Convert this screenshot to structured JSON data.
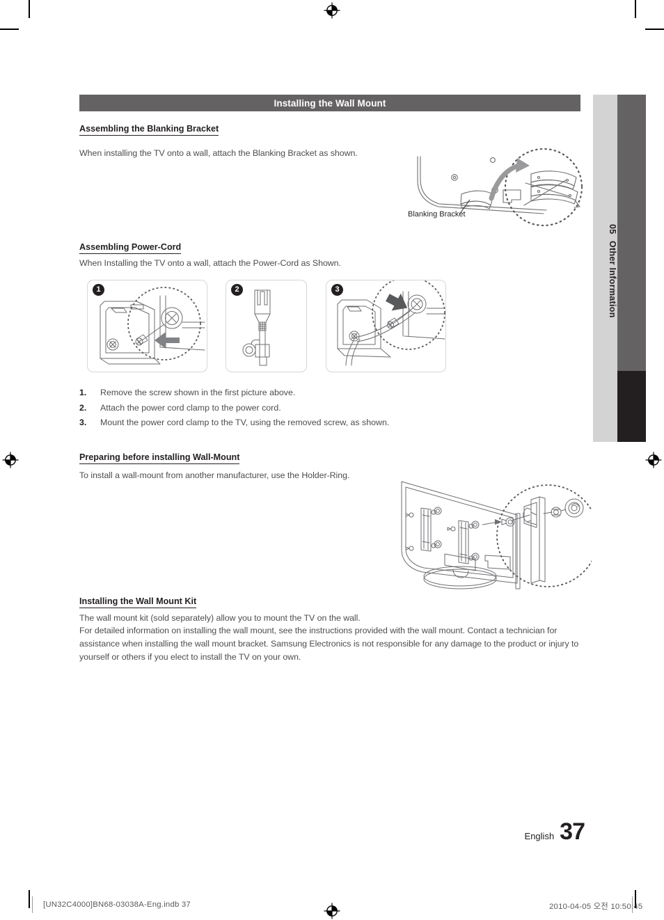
{
  "document": {
    "section_title": "Installing the Wall Mount",
    "language": "English",
    "page_number": "37"
  },
  "sidebar": {
    "chapter_number": "05",
    "chapter_label": "Other Information",
    "colors": {
      "light": "#d3d3d3",
      "dark": "#656263",
      "black": "#231f20"
    }
  },
  "sections": {
    "blanking_bracket": {
      "heading": "Assembling the Blanking Bracket",
      "body": "When installing the TV onto a wall, attach the Blanking Bracket as shown.",
      "figure_caption": "Blanking Bracket"
    },
    "power_cord": {
      "heading": "Assembling Power-Cord",
      "body": "When Installing the TV onto a wall, attach the Power-Cord as Shown.",
      "panels": [
        {
          "badge": "1"
        },
        {
          "badge": "2"
        },
        {
          "badge": "3"
        }
      ],
      "steps": [
        {
          "num": "1.",
          "text": "Remove the screw shown in the first picture above."
        },
        {
          "num": "2.",
          "text": "Attach the power cord clamp to the power cord."
        },
        {
          "num": "3.",
          "text": "Mount the power cord clamp to the TV, using the removed screw, as shown."
        }
      ]
    },
    "preparing": {
      "heading": "Preparing before installing Wall-Mount",
      "body": "To install a wall-mount from another manufacturer, use the Holder-Ring."
    },
    "wall_mount_kit": {
      "heading": "Installing the Wall Mount Kit",
      "body_line1": "The wall mount kit (sold separately) allow you to mount the TV on the wall.",
      "body_line2": "For detailed information on installing the wall mount, see the instructions provided with the wall mount. Contact a technician for assistance when installing the wall mount bracket. Samsung Electronics is not responsible for any damage to the product or injury to yourself or others if you elect to install the TV on your own."
    }
  },
  "footer": {
    "file_info": "[UN32C4000]BN68-03038A-Eng.indb   37",
    "timestamp": "2010-04-05   오전 10:50:45"
  }
}
